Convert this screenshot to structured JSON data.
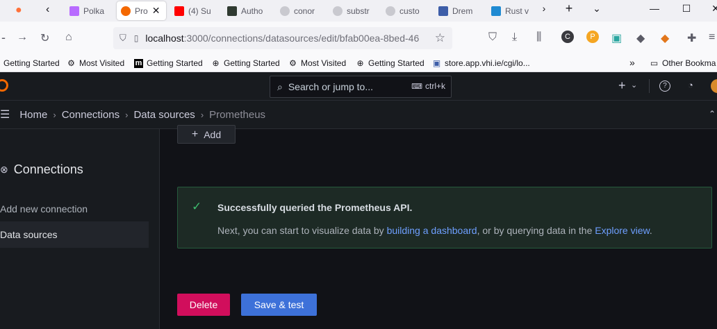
{
  "browser": {
    "tabs": [
      {
        "label": "Polka",
        "color": "#b86bff"
      },
      {
        "label": "Pro",
        "color": "#f46800",
        "active": true
      },
      {
        "label": "(4) Su",
        "color": "#ff0000"
      },
      {
        "label": "Autho",
        "color": "#2f3a31"
      },
      {
        "label": "conor",
        "color": "#c9c9cf"
      },
      {
        "label": "substr",
        "color": "#c9c9cf"
      },
      {
        "label": "custo",
        "color": "#c9c9cf"
      },
      {
        "label": "Drem",
        "color": "#3d5da8"
      },
      {
        "label": "Rust v",
        "color": "#1f8ad2"
      }
    ],
    "url": {
      "host": "localhost",
      "rest": ":3000/connections/datasources/edit/bfab00ea-8bed-46"
    },
    "bookmarks": [
      {
        "label": "Getting Started",
        "icon": "firefox-icon"
      },
      {
        "label": "Most Visited",
        "icon": "gear-icon"
      },
      {
        "label": "Getting Started",
        "icon": "m-logo-icon"
      },
      {
        "label": "Getting Started",
        "icon": "globe-icon"
      },
      {
        "label": "Most Visited",
        "icon": "gear-icon"
      },
      {
        "label": "Getting Started",
        "icon": "globe-icon"
      },
      {
        "label": "store.app.vhi.ie/cgi/lo...",
        "icon": "bookmark-site-icon"
      }
    ],
    "other_bookmarks": "Other Bookma"
  },
  "grafana": {
    "search_placeholder": "Search or jump to...",
    "search_shortcut": "ctrl+k",
    "breadcrumb": [
      "Home",
      "Connections",
      "Data sources",
      "Prometheus"
    ],
    "sidebar": {
      "title": "Connections",
      "items": [
        {
          "label": "Add new connection",
          "active": false
        },
        {
          "label": "Data sources",
          "active": true
        }
      ]
    },
    "add_button": "Add",
    "alert": {
      "title": "Successfully queried the Prometheus API.",
      "body_prefix": "Next, you can start to visualize data by ",
      "link1": "building a dashboard",
      "body_middle": ", or by querying data in the ",
      "link2": "Explore view",
      "body_suffix": "."
    },
    "delete_button": "Delete",
    "save_button": "Save & test"
  },
  "colors": {
    "delete": "#d10e5c",
    "save": "#3d71d9",
    "success": "#3ebc6e",
    "link": "#6e9fff"
  }
}
